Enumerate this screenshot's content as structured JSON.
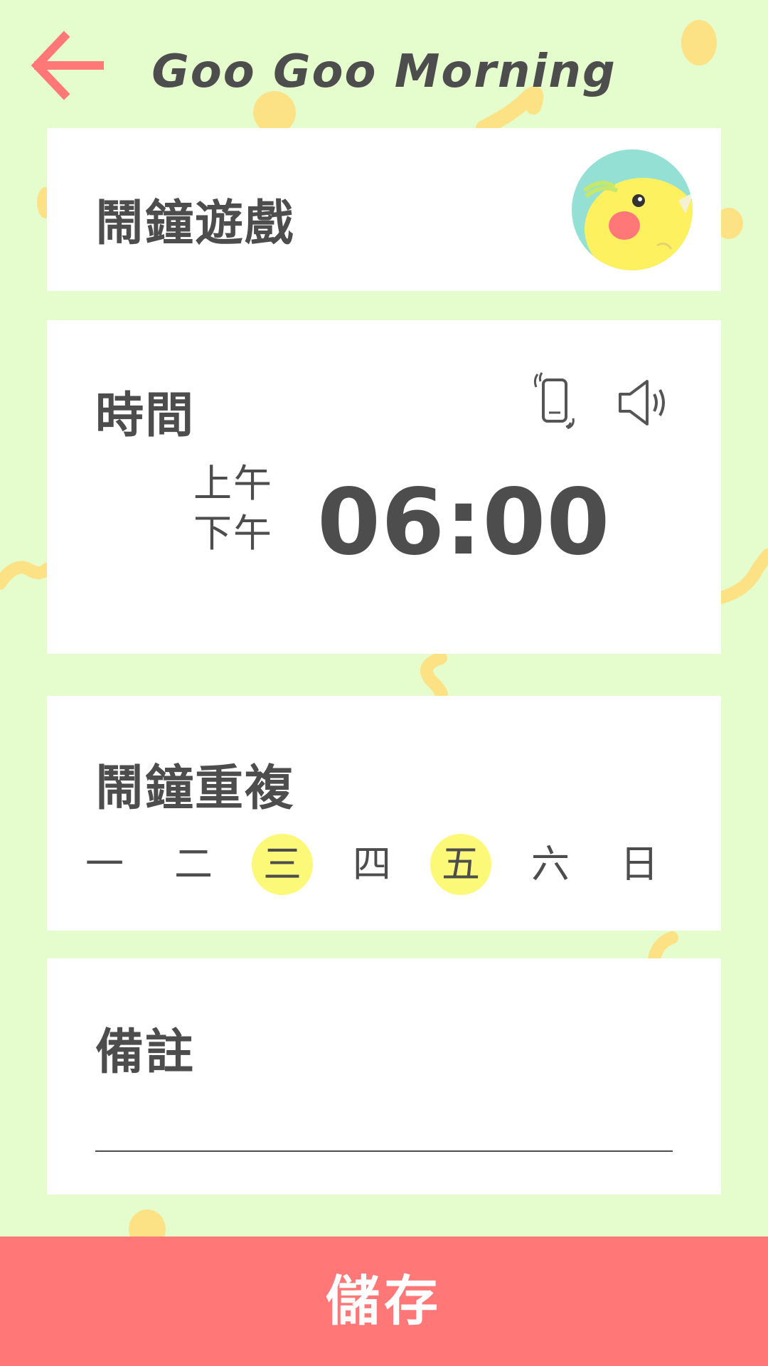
{
  "header": {
    "title": "Goo Goo Morning",
    "back_icon": "arrow-left-icon",
    "back_color": "#ff7777"
  },
  "game_card": {
    "title": "鬧鐘遊戲",
    "avatar_icon": "bird-icon"
  },
  "time_card": {
    "title": "時間",
    "vibrate_icon": "vibrate-phone-icon",
    "sound_icon": "speaker-icon",
    "am_label": "上午",
    "pm_label": "下午",
    "time": "06:00"
  },
  "repeat_card": {
    "title": "鬧鐘重複",
    "days": [
      {
        "label": "一",
        "selected": false
      },
      {
        "label": "二",
        "selected": false
      },
      {
        "label": "三",
        "selected": true
      },
      {
        "label": "四",
        "selected": false
      },
      {
        "label": "五",
        "selected": true
      },
      {
        "label": "六",
        "selected": false
      },
      {
        "label": "日",
        "selected": false
      }
    ],
    "selected_color": "#fdf978"
  },
  "note_card": {
    "title": "備註",
    "value": ""
  },
  "save_button": {
    "label": "儲存",
    "color": "#ff7777"
  },
  "colors": {
    "background": "#e5fdcd",
    "text": "#4d4d4d",
    "deco": "#fde185"
  }
}
